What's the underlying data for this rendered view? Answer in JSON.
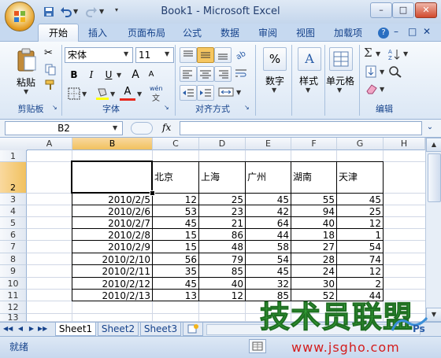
{
  "window": {
    "title": "Book1 - Microsoft Excel"
  },
  "tabs": [
    "开始",
    "插入",
    "页面布局",
    "公式",
    "数据",
    "审阅",
    "视图",
    "加载项"
  ],
  "ribbon": {
    "clipboard": {
      "paste_label": "粘贴",
      "group_label": "剪贴板"
    },
    "font": {
      "name": "宋体",
      "size": "11",
      "bold": "B",
      "italic": "I",
      "underline": "U",
      "grow": "A",
      "shrink": "A",
      "color_letter": "A",
      "group_label": "字体",
      "wen": "wén"
    },
    "alignment": {
      "group_label": "对齐方式"
    },
    "number": {
      "label": "数字",
      "icon_text": "%"
    },
    "styles": {
      "label": "样式",
      "icon_text": "A"
    },
    "cells": {
      "label": "单元格"
    },
    "editing": {
      "group_label": "编辑",
      "sigma": "Σ"
    }
  },
  "formula_bar": {
    "name_box": "B2",
    "fx": "fx",
    "formula": ""
  },
  "columns": [
    "A",
    "B",
    "C",
    "D",
    "E",
    "F",
    "G",
    "H"
  ],
  "rows": [
    "1",
    "2",
    "3",
    "4",
    "5",
    "6",
    "7",
    "8",
    "9",
    "10",
    "11",
    "12",
    "13"
  ],
  "table": {
    "headers": [
      "北京",
      "上海",
      "广州",
      "湖南",
      "天津"
    ],
    "rows": [
      {
        "date": "2010/2/5",
        "values": [
          "12",
          "25",
          "45",
          "55",
          "45"
        ]
      },
      {
        "date": "2010/2/6",
        "values": [
          "53",
          "23",
          "42",
          "94",
          "25"
        ]
      },
      {
        "date": "2010/2/7",
        "values": [
          "45",
          "21",
          "64",
          "40",
          "12"
        ]
      },
      {
        "date": "2010/2/8",
        "values": [
          "15",
          "86",
          "44",
          "18",
          "1"
        ]
      },
      {
        "date": "2010/2/9",
        "values": [
          "15",
          "48",
          "58",
          "27",
          "54"
        ]
      },
      {
        "date": "2010/2/10",
        "values": [
          "56",
          "79",
          "54",
          "28",
          "74"
        ]
      },
      {
        "date": "2010/2/11",
        "values": [
          "35",
          "85",
          "45",
          "24",
          "12"
        ]
      },
      {
        "date": "2010/2/12",
        "values": [
          "45",
          "40",
          "32",
          "30",
          "2"
        ]
      },
      {
        "date": "2010/2/13",
        "values": [
          "13",
          "12",
          "85",
          "52",
          "44"
        ]
      }
    ]
  },
  "sheets": [
    "Sheet1",
    "Sheet2",
    "Sheet3"
  ],
  "status": {
    "text": "就绪"
  },
  "watermark": {
    "main": "技术员联盟",
    "url": "www.jsgho.com",
    "logo_text": "Ps"
  }
}
